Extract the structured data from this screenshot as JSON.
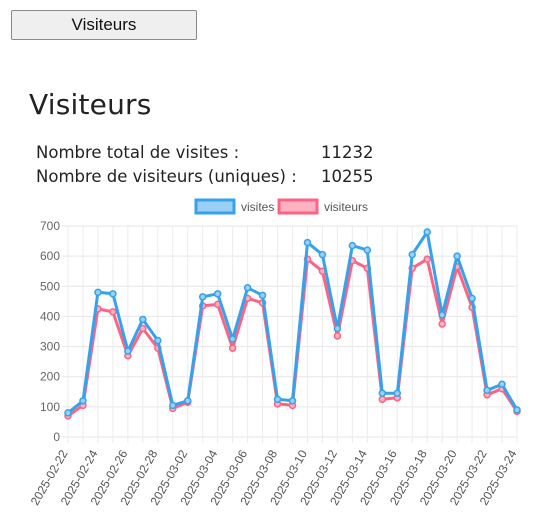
{
  "header": {
    "button_label": "Visiteurs"
  },
  "page": {
    "title": "Visiteurs"
  },
  "stats": [
    {
      "label": "Nombre total de visites :",
      "value": "11232"
    },
    {
      "label": "Nombre de visiteurs (uniques) :",
      "value": "10255"
    }
  ],
  "chart_data": {
    "type": "line",
    "title": "",
    "xlabel": "",
    "ylabel": "",
    "ylim": [
      0,
      700
    ],
    "yticks": [
      0,
      100,
      200,
      300,
      400,
      500,
      600,
      700
    ],
    "grid": true,
    "legend_position": "top",
    "x": [
      "2025-02-22",
      "2025-02-23",
      "2025-02-24",
      "2025-02-25",
      "2025-02-26",
      "2025-02-27",
      "2025-02-28",
      "2025-03-01",
      "2025-03-02",
      "2025-03-03",
      "2025-03-04",
      "2025-03-05",
      "2025-03-06",
      "2025-03-07",
      "2025-03-08",
      "2025-03-09",
      "2025-03-10",
      "2025-03-11",
      "2025-03-12",
      "2025-03-13",
      "2025-03-14",
      "2025-03-15",
      "2025-03-16",
      "2025-03-17",
      "2025-03-18",
      "2025-03-19",
      "2025-03-20",
      "2025-03-21",
      "2025-03-22",
      "2025-03-23",
      "2025-03-24"
    ],
    "xtick_labels": [
      "2025-02-22",
      "2025-02-24",
      "2025-02-26",
      "2025-02-28",
      "2025-03-02",
      "2025-03-04",
      "2025-03-06",
      "2025-03-08",
      "2025-03-10",
      "2025-03-12",
      "2025-03-14",
      "2025-03-16",
      "2025-03-18",
      "2025-03-20",
      "2025-03-22",
      "2025-03-24"
    ],
    "series": [
      {
        "name": "visites",
        "color": "#36a2eb",
        "fill": "#9ad0f5",
        "values": [
          80,
          120,
          480,
          475,
          285,
          390,
          320,
          105,
          120,
          465,
          475,
          325,
          495,
          470,
          125,
          120,
          645,
          605,
          360,
          635,
          620,
          145,
          145,
          605,
          680,
          405,
          600,
          460,
          155,
          175,
          90
        ]
      },
      {
        "name": "visiteurs",
        "color": "#ff6384",
        "fill": "#ffb1c1",
        "values": [
          70,
          105,
          425,
          415,
          270,
          360,
          295,
          95,
          115,
          435,
          440,
          295,
          460,
          445,
          110,
          105,
          590,
          550,
          335,
          585,
          560,
          125,
          130,
          560,
          590,
          375,
          565,
          430,
          140,
          160,
          85
        ]
      }
    ]
  }
}
